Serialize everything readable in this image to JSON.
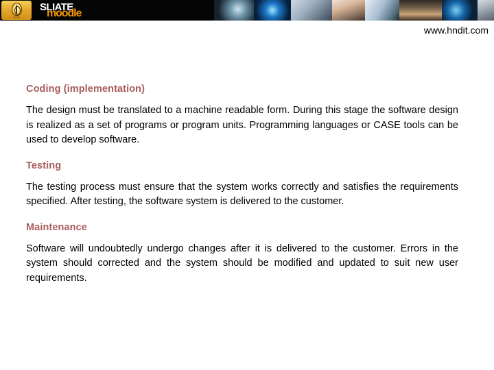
{
  "banner": {
    "badge_icon": "sliate-crest-emblem",
    "badge_caption": "SLIATE",
    "wordmark_primary": "SLIATE",
    "wordmark_secondary": "moodle",
    "photo_strip": [
      "astronaut-photo",
      "blue-globe-eye-photo",
      "chat-bubbles-hand-photo",
      "couple-embrace-photo",
      "hands-keyboard-photo",
      "classroom-students-photo",
      "globe-flare-photo",
      "robot-android-photo",
      "blue-eye-closeup-photo"
    ],
    "background_color": "#050505",
    "badge_color": "#e8a82e",
    "wordmark_secondary_color": "#f29407"
  },
  "url": "www.hndit.com",
  "content": {
    "heading_color": "#a85c5c",
    "sections": [
      {
        "heading": "Coding  (implementation)",
        "body": "The design must be translated to a machine readable form.  During this stage the software design is realized as a set of programs or program units.  Programming languages or CASE tools can be used to develop software."
      },
      {
        "heading": "Testing",
        "body": "The testing process must ensure that the system works correctly and satisfies the requirements specified. After testing,   the software system is delivered to the customer."
      },
      {
        "heading": "Maintenance",
        "body": "Software will undoubtedly undergo changes after it is delivered to the customer. Errors in the system should corrected and the system should be modified and updated to suit new user requirements."
      }
    ]
  }
}
